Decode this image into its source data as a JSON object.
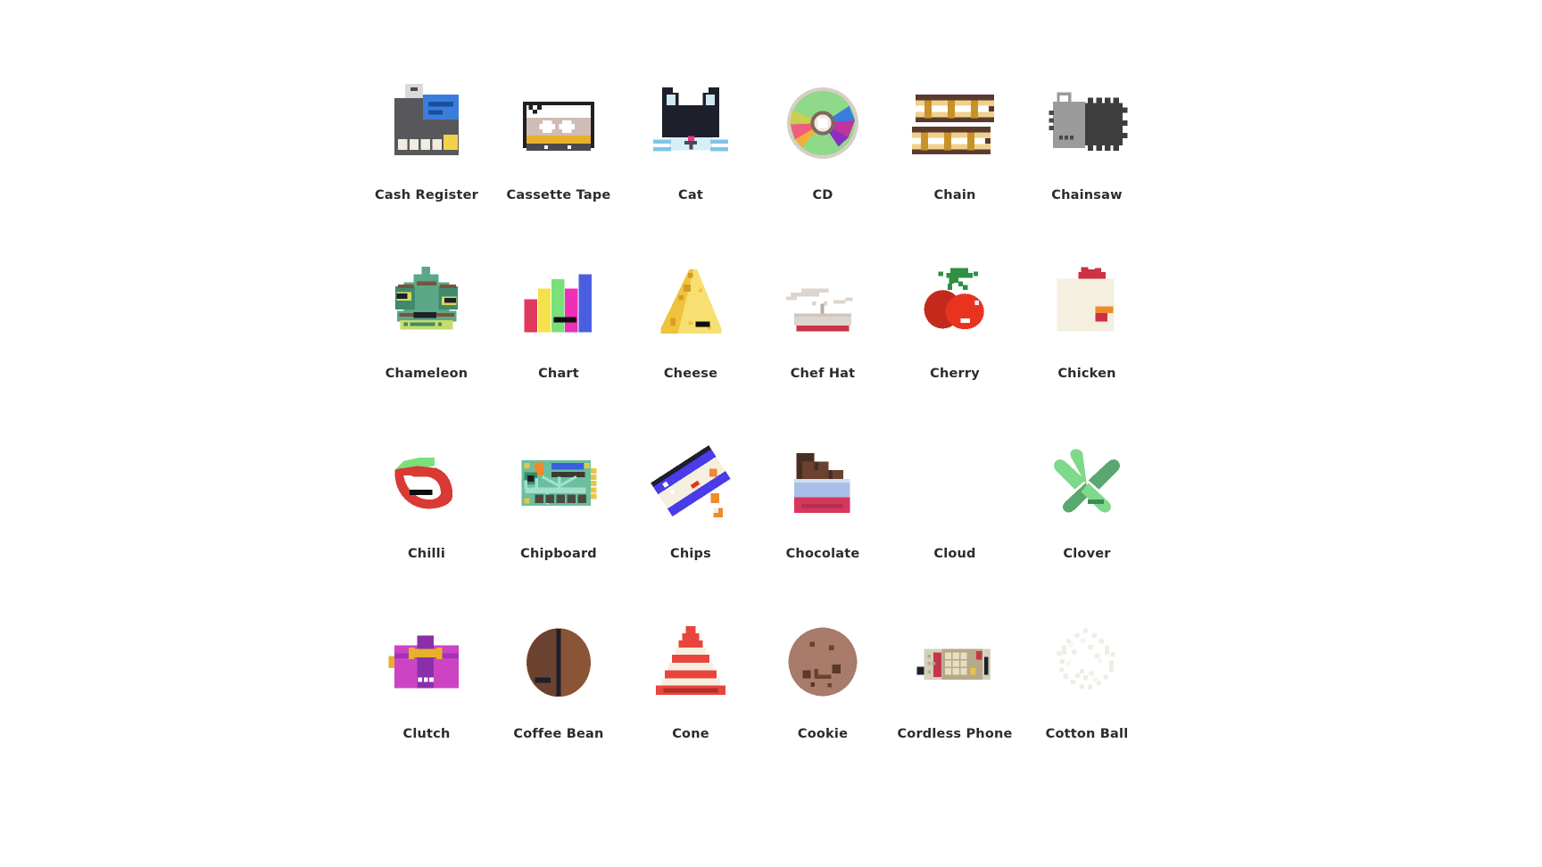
{
  "page": {
    "background": "#ffffff",
    "title_text_color": "#2b2b2f",
    "layout": {
      "columns": 6,
      "rows": 4,
      "total_items": 24
    }
  },
  "gallery": {
    "items": [
      {
        "id": "cash-register",
        "label": "Cash Register",
        "row": 1,
        "col": 1,
        "palette": {
          "body": "#58585a",
          "screen": "#3b7ddd",
          "screen_line": "#1b4f9e",
          "keys": "#f0ece1",
          "accent": "#f3d24b",
          "top": "#d9d9db",
          "top_dark": "#4a4a4c"
        }
      },
      {
        "id": "cassette-tape",
        "label": "Cassette Tape",
        "row": 1,
        "col": 2,
        "palette": {
          "shell": "#cfbcb4",
          "outline": "#231f20",
          "label": "#ffffff",
          "band": "#e8b12c",
          "base": "#4a4a4c",
          "hub": "#ffffff"
        }
      },
      {
        "id": "cat",
        "label": "Cat",
        "row": 1,
        "col": 3,
        "palette": {
          "fur": "#1d1f2b",
          "inner_ear": "#cfe8f2",
          "water": "#d6eef8",
          "stripe": "#7fc4e8",
          "nose": "#e8398f"
        }
      },
      {
        "id": "cd",
        "label": "CD",
        "row": 1,
        "col": 4,
        "palette": {
          "green": "#8fd98a",
          "pink": "#ef5e7e",
          "orange": "#f2b134",
          "blue": "#3b7ddd",
          "magenta": "#c0349d",
          "purple": "#8a2fc0",
          "olive": "#c9d14f",
          "rim": "#d9cec6",
          "hub": "#7d6a5c",
          "hub_in": "#efe8e0"
        }
      },
      {
        "id": "chain",
        "label": "Chain",
        "row": 1,
        "col": 5,
        "palette": {
          "dark": "#5b3a2e",
          "light": "#f0d08a",
          "mid": "#c8922a",
          "hole": "#ffffff"
        }
      },
      {
        "id": "chainsaw",
        "label": "Chainsaw",
        "row": 1,
        "col": 6,
        "palette": {
          "body": "#9b9b9b",
          "bar": "#3d3d3d",
          "teeth": "#3d3d3d",
          "vent": "#4a4a4c",
          "handle": "#9b9b9b"
        }
      },
      {
        "id": "chameleon",
        "label": "Chameleon",
        "row": 2,
        "col": 1,
        "palette": {
          "body": "#5aa888",
          "dark": "#7a5340",
          "eye_yellow": "#d8d95c",
          "eye_black": "#1d1f2b",
          "belly": "#c6dc6a",
          "mouth": "#1d1f2b",
          "green_dark": "#3f8a6a"
        }
      },
      {
        "id": "chart",
        "label": "Chart",
        "row": 2,
        "col": 2,
        "palette": {
          "bar1": "#e0395f",
          "bar2": "#f5e24a",
          "bar3": "#79e07a",
          "bar4": "#ef2fb5",
          "bar5": "#4a5fe0",
          "mark": "#0e0e12"
        }
      },
      {
        "id": "cheese",
        "label": "Cheese",
        "row": 2,
        "col": 3,
        "palette": {
          "light": "#f7e071",
          "mid": "#f0c33c",
          "hole": "#d79a28",
          "mouth": "#0e0e12"
        }
      },
      {
        "id": "chef-hat",
        "label": "Chef Hat",
        "row": 2,
        "col": 4,
        "palette": {
          "puff": "#ddd5cd",
          "band": "#b9ada4",
          "base": "#cc3144",
          "line": "#cfc6bd"
        }
      },
      {
        "id": "cherry",
        "label": "Cherry",
        "row": 2,
        "col": 5,
        "palette": {
          "dark_red": "#c42a1c",
          "red": "#e8341f",
          "stem": "#2f8f43",
          "leaf": "#2f8f43",
          "shine": "#ffffff"
        }
      },
      {
        "id": "chicken",
        "label": "Chicken",
        "row": 2,
        "col": 6,
        "palette": {
          "body": "#f5efe0",
          "comb": "#cc3144",
          "beak": "#ef8a2c",
          "wattle": "#cc3144"
        }
      },
      {
        "id": "chilli",
        "label": "Chilli",
        "row": 3,
        "col": 1,
        "palette": {
          "red": "#d93b34",
          "green": "#79e07a",
          "mouth": "#0e0e12"
        }
      },
      {
        "id": "chipboard",
        "label": "Chipboard",
        "row": 3,
        "col": 2,
        "palette": {
          "board": "#6bbf9a",
          "trace": "#9fe0cf",
          "chip": "#4a4a42",
          "gold": "#e8c547",
          "orange": "#ef8a2c",
          "blue": "#3b5fe0",
          "dark": "#3a3a32",
          "green_dark": "#3f8a6a"
        }
      },
      {
        "id": "chips",
        "label": "Chips",
        "row": 3,
        "col": 3,
        "palette": {
          "bag": "#f5efe0",
          "blue": "#4a3ce8",
          "dark": "#1d1f2b",
          "orange": "#ef8a2c",
          "red": "#e8341f"
        }
      },
      {
        "id": "chocolate",
        "label": "Chocolate",
        "row": 3,
        "col": 4,
        "palette": {
          "choc_dark": "#4a2d22",
          "choc": "#6b4230",
          "wrap_blue": "#a8c0e8",
          "wrap_red": "#d8365c",
          "line": "#b03050",
          "top": "#cfe0f2"
        }
      },
      {
        "id": "cloud",
        "label": "Cloud",
        "row": 3,
        "col": 5,
        "palette": {
          "fill": "#ffffff"
        }
      },
      {
        "id": "clover",
        "label": "Clover",
        "row": 3,
        "col": 6,
        "palette": {
          "light": "#7ed98a",
          "dark": "#5aa870",
          "stem": "#3f8a5a"
        }
      },
      {
        "id": "clutch",
        "label": "Clutch",
        "row": 4,
        "col": 1,
        "palette": {
          "body": "#cc44c4",
          "strap": "#8a2fa8",
          "clasp": "#e8b12c",
          "dot": "#ffffff",
          "line": "#a033b8"
        }
      },
      {
        "id": "coffee-bean",
        "label": "Coffee Bean",
        "row": 4,
        "col": 2,
        "palette": {
          "bean": "#8a5436",
          "bean_dark": "#6b4230",
          "split": "#1d1f2b"
        }
      },
      {
        "id": "cone",
        "label": "Cone",
        "row": 4,
        "col": 3,
        "palette": {
          "red": "#e8453c",
          "white": "#f5efe0",
          "base": "#e8453c",
          "base_line": "#b03028"
        }
      },
      {
        "id": "cookie",
        "label": "Cookie",
        "row": 4,
        "col": 4,
        "palette": {
          "dough": "#a87b6a",
          "chip": "#6b4230",
          "chip_dark": "#5a3828"
        }
      },
      {
        "id": "cordless-phone",
        "label": "Cordless Phone",
        "row": 4,
        "col": 5,
        "palette": {
          "body": "#d6cfbd",
          "keys": "#e8dfc0",
          "keypad": "#b5a98a",
          "screen": "#c4364a",
          "antenna": "#1d1f2b",
          "accent": "#c4364a"
        }
      },
      {
        "id": "cotton-ball",
        "label": "Cotton Ball",
        "row": 4,
        "col": 6,
        "palette": {
          "fill": "#f0ede4",
          "fill_soft": "#f7f5ef"
        }
      }
    ]
  }
}
